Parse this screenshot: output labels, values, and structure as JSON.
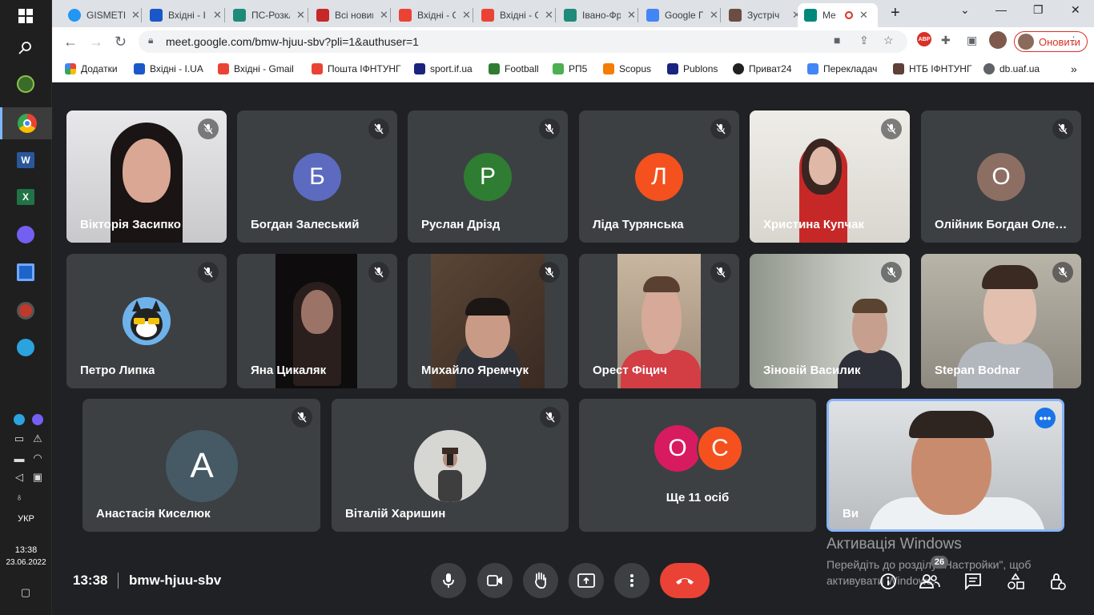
{
  "browser": {
    "tabs": [
      {
        "label": "GISMETEO",
        "color": "#2196f3"
      },
      {
        "label": "Вхідні - I.UA",
        "color": "#1a57c9"
      },
      {
        "label": "ПС-Розклад",
        "color": "#1e8a7a"
      },
      {
        "label": "Всі новини",
        "color": "#c62828"
      },
      {
        "label": "Вхідні - Gmail",
        "color": "#ea4335"
      },
      {
        "label": "Вхідні - Gmail",
        "color": "#ea4335"
      },
      {
        "label": "Івано-Франківськ",
        "color": "#1e8a7a"
      },
      {
        "label": "Google Перекладач",
        "color": "#4285f4"
      },
      {
        "label": "Зустріч",
        "color": "#6d4c41"
      },
      {
        "label": "Me",
        "color": "#00897b"
      }
    ],
    "url": "meet.google.com/bmw-hjuu-sbv?pli=1&authuser=1",
    "update_label": "Оновити",
    "bookmarks": [
      {
        "label": "Додатки",
        "color": "#4285f4"
      },
      {
        "label": "Вхідні - I.UA",
        "color": "#1a57c9"
      },
      {
        "label": "Вхідні - Gmail",
        "color": "#ea4335"
      },
      {
        "label": "Пошта ІФНТУНГ",
        "color": "#ea4335"
      },
      {
        "label": "sport.if.ua",
        "color": "#1a237e"
      },
      {
        "label": "Football",
        "color": "#2e7d32"
      },
      {
        "label": "РП5",
        "color": "#4caf50"
      },
      {
        "label": "Scopus",
        "color": "#f57c00"
      },
      {
        "label": "Publons",
        "color": "#1a237e"
      },
      {
        "label": "Приват24",
        "color": "#212121"
      },
      {
        "label": "Перекладач",
        "color": "#4285f4"
      },
      {
        "label": "НТБ ІФНТУНГ",
        "color": "#5d4037"
      },
      {
        "label": "db.uaf.ua",
        "color": "#5f6368"
      }
    ]
  },
  "taskbar": {
    "lang": "УКР",
    "time": "13:38",
    "date": "23.06.2022"
  },
  "participants": [
    {
      "name": "Вікторія Засипко",
      "type": "video"
    },
    {
      "name": "Богдан Залеський",
      "type": "avatar",
      "initial": "Б",
      "color": "#5c6bc0"
    },
    {
      "name": "Руслан Дрізд",
      "type": "avatar",
      "initial": "Р",
      "color": "#2e7d32"
    },
    {
      "name": "Ліда Турянська",
      "type": "avatar",
      "initial": "Л",
      "color": "#f4511e"
    },
    {
      "name": "Христина Купчак",
      "type": "video"
    },
    {
      "name": "Олійник Богдан Олегович",
      "type": "avatar",
      "initial": "О",
      "color": "#8d6e63"
    },
    {
      "name": "Петро Липка",
      "type": "image"
    },
    {
      "name": "Яна Цикаляк",
      "type": "video"
    },
    {
      "name": "Михайло Яремчук",
      "type": "video"
    },
    {
      "name": "Орест Фіцич",
      "type": "video"
    },
    {
      "name": "Зіновій Василик",
      "type": "video"
    },
    {
      "name": "Stepan Bodnar",
      "type": "video"
    },
    {
      "name": "Анастасія Киселюк",
      "type": "avatar",
      "initial": "А",
      "color": "#455a64"
    },
    {
      "name": "Віталій Харишин",
      "type": "image"
    }
  ],
  "others": {
    "label": "Ще 11 осіб",
    "avatars": [
      {
        "initial": "О",
        "color": "#d81b60"
      },
      {
        "initial": "С",
        "color": "#f4511e"
      }
    ]
  },
  "self": {
    "name": "Ви"
  },
  "meeting": {
    "time": "13:38",
    "code": "bmw-hjuu-sbv",
    "participant_count": "26"
  },
  "watermark": {
    "title": "Активація Windows",
    "text": "Перейдіть до розділу \"Настройки\", щоб активувати Windows."
  }
}
